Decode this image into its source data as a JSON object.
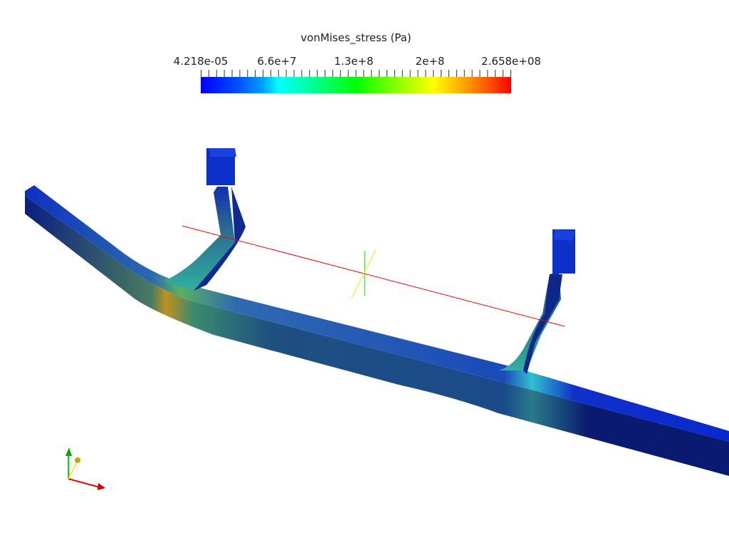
{
  "colorbar": {
    "title": "vonMises_stress (Pa)",
    "labels": [
      "4.218e-05",
      "6.6e+7",
      "1.3e+8",
      "2e+8",
      "2.658e+08"
    ],
    "range": [
      4.218e-05,
      265800000
    ],
    "colormap": [
      "#0000ff",
      "#00ffff",
      "#00ff00",
      "#ffff00",
      "#ff0000"
    ]
  },
  "axes": {
    "x_color": "#ff0000",
    "y_color": "#00cc00",
    "z_color": "#dddd00"
  }
}
